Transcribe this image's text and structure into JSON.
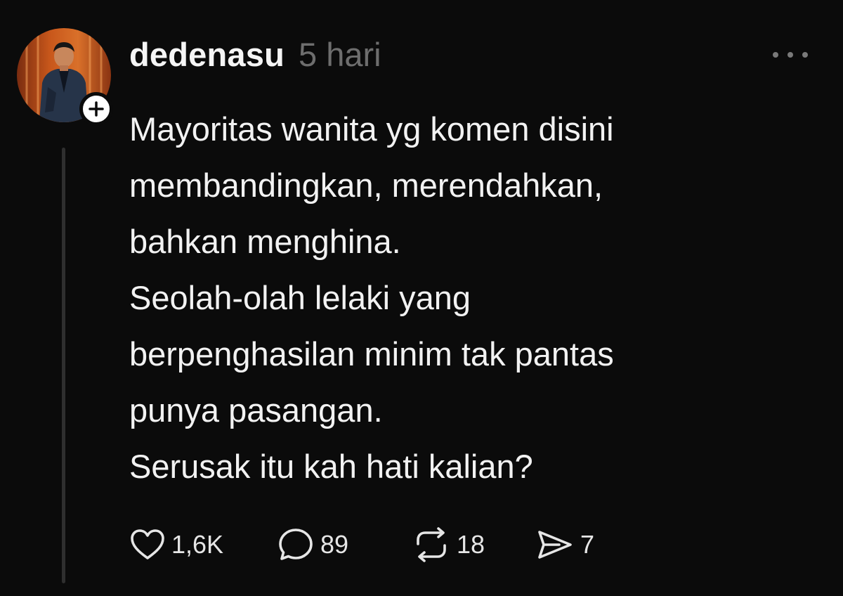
{
  "post": {
    "username": "dedenasu",
    "timestamp": "5 hari",
    "text_lines": [
      "Mayoritas wanita yg komen disini",
      "membandingkan, merendahkan,",
      "bahkan menghina.",
      "Seolah-olah lelaki yang",
      "berpenghasilan minim tak pantas",
      "punya pasangan.",
      "Serusak itu kah hati kalian?"
    ]
  },
  "actions": {
    "likes": "1,6K",
    "replies": "89",
    "reposts": "18",
    "shares": "7"
  },
  "icons": {
    "avatar": "profile-photo",
    "follow": "plus-icon",
    "more": "more-horizontal-icon",
    "like": "heart-icon",
    "reply": "comment-icon",
    "repost": "repost-icon",
    "share": "send-icon"
  },
  "colors": {
    "background": "#0b0b0b",
    "text": "#f2f2f2",
    "muted": "#6e6e6e"
  }
}
